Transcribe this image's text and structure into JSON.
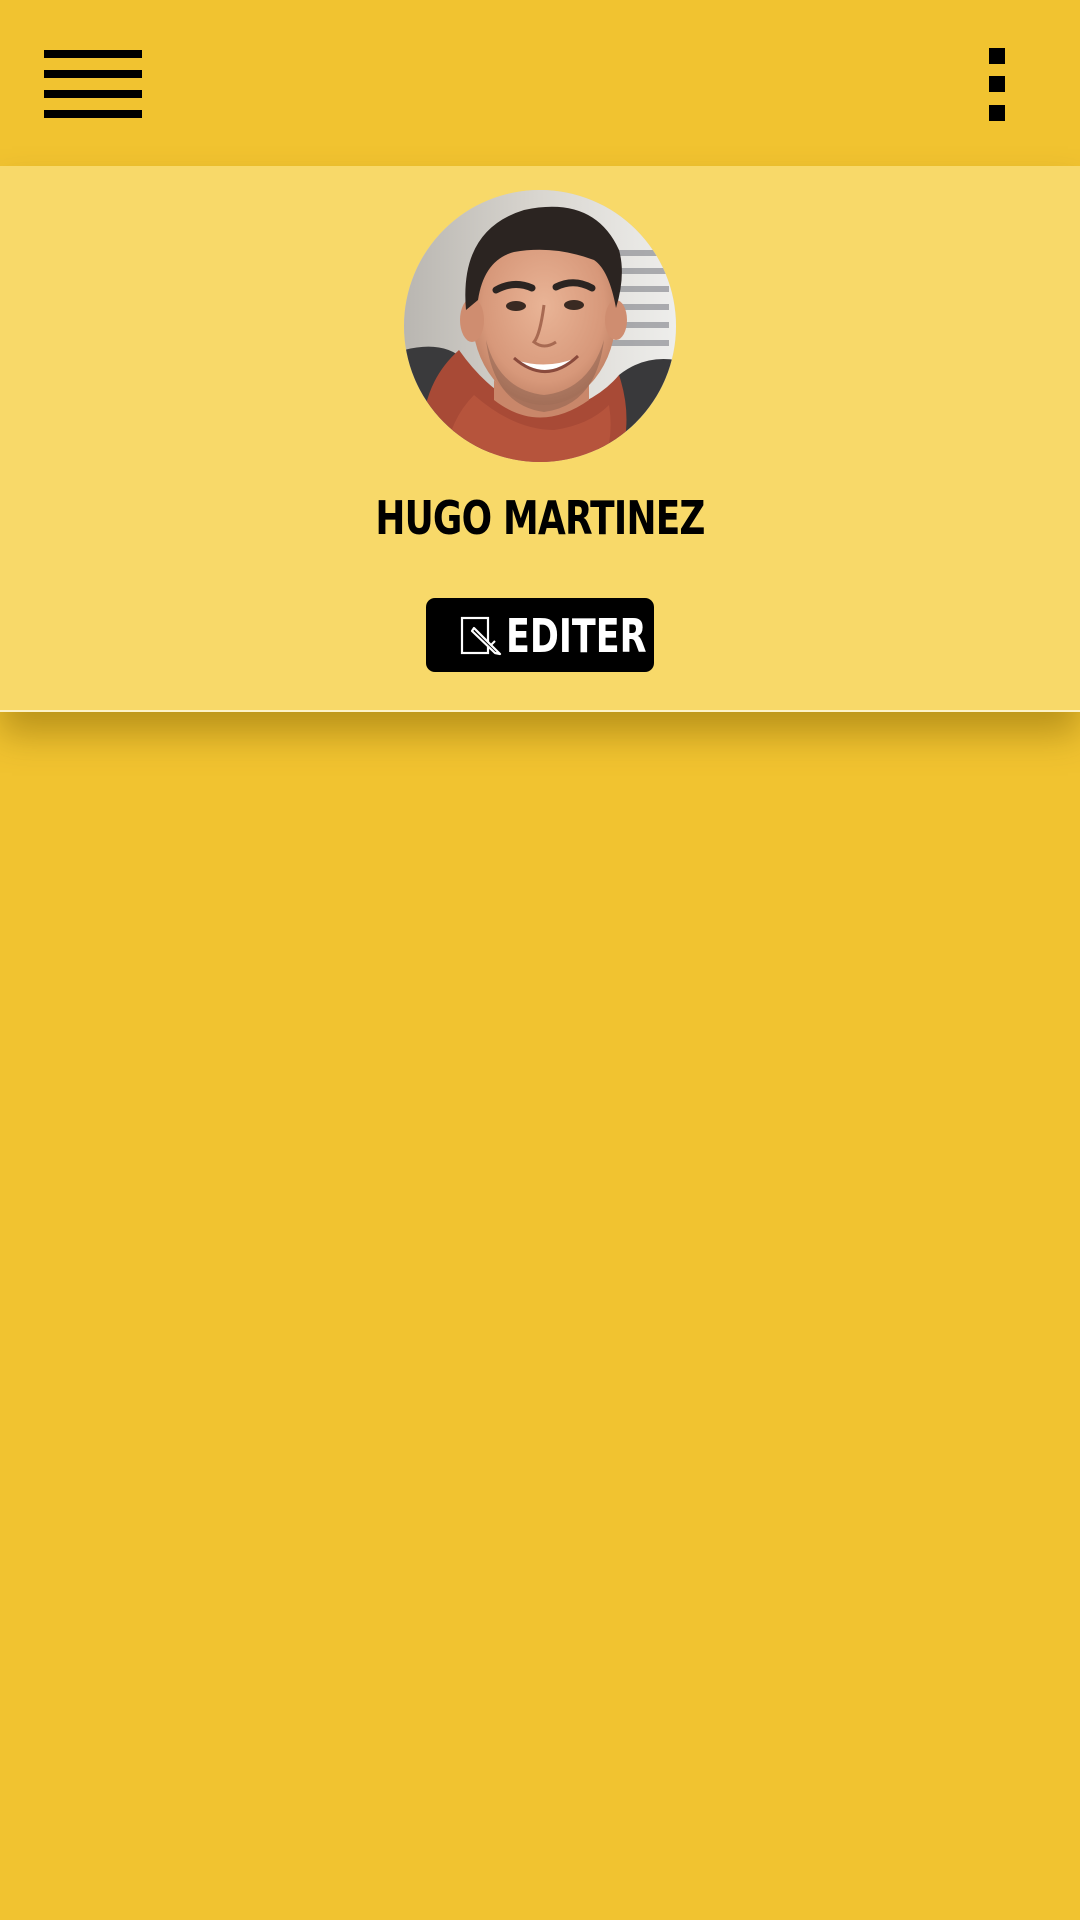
{
  "topbar": {
    "menu_icon": "hamburger-menu-icon",
    "more_icon": "more-vertical-icon"
  },
  "profile": {
    "name": "HUGO MARTINEZ",
    "avatar": "profile-photo",
    "edit_button": {
      "icon": "edit-document-icon",
      "label": "EDITER"
    }
  },
  "colors": {
    "primary": "#F1C330",
    "panel": "#F8D969",
    "button": "#000000",
    "button_text": "#FFFFFF"
  }
}
